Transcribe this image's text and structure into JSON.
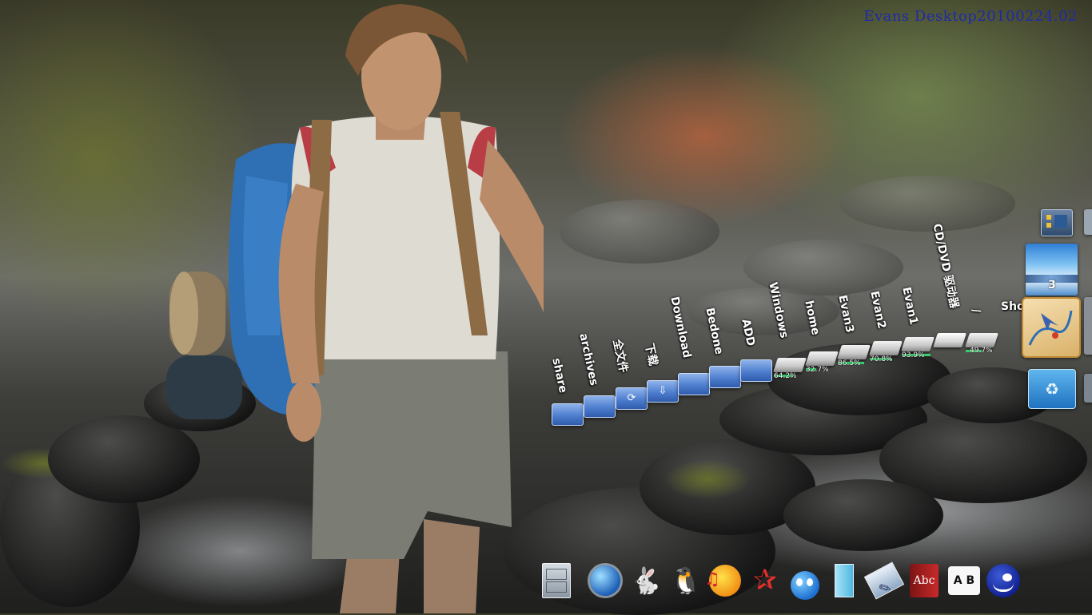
{
  "desktop": {
    "watermark": "Evans Desktop20100224.02"
  },
  "shelf": {
    "items": [
      {
        "id": "share",
        "label": "share",
        "kind": "folder",
        "glyph": ""
      },
      {
        "id": "archives",
        "label": "archives",
        "kind": "folder",
        "glyph": ""
      },
      {
        "id": "sync",
        "label": "全文件",
        "kind": "folder",
        "glyph": "⟳"
      },
      {
        "id": "downloads-cn",
        "label": "下载",
        "kind": "folder",
        "glyph": "⇩"
      },
      {
        "id": "download",
        "label": "Download",
        "kind": "folder",
        "glyph": ""
      },
      {
        "id": "bedone",
        "label": "Bedone",
        "kind": "folder",
        "glyph": ""
      },
      {
        "id": "add",
        "label": "ADD",
        "kind": "folder",
        "glyph": ""
      },
      {
        "id": "windows",
        "label": "Windows",
        "kind": "drive",
        "usage": "64.2%"
      },
      {
        "id": "home",
        "label": "home",
        "kind": "drive",
        "usage": "32.7%"
      },
      {
        "id": "evan3",
        "label": "Evan3",
        "kind": "drive",
        "usage": "86.5%"
      },
      {
        "id": "evan2",
        "label": "Evan2",
        "kind": "drive",
        "usage": "70.8%"
      },
      {
        "id": "evan1",
        "label": "Evan1",
        "kind": "drive",
        "usage": "93.9%"
      },
      {
        "id": "cdrom",
        "label": "CD/DVD 驱动器",
        "kind": "disc",
        "usage": ""
      },
      {
        "id": "root",
        "label": "/",
        "kind": "drive",
        "usage": "49.7%"
      }
    ]
  },
  "right_panel": {
    "workspace_number": "3",
    "shortcuts_label": "Shortcuts"
  },
  "dock": {
    "items": [
      {
        "id": "file-cabinet",
        "icon": "file-cabinet-icon"
      },
      {
        "id": "browser",
        "icon": "globe-icon"
      },
      {
        "id": "bunny",
        "icon": "rabbit-icon"
      },
      {
        "id": "tux",
        "icon": "penguin-icon"
      },
      {
        "id": "music",
        "icon": "music-player-icon"
      },
      {
        "id": "star",
        "icon": "star-icon"
      },
      {
        "id": "messenger",
        "icon": "messenger-icon"
      },
      {
        "id": "window",
        "icon": "window-icon"
      },
      {
        "id": "quill",
        "icon": "quill-icon"
      },
      {
        "id": "dictionary",
        "icon": "dictionary-icon",
        "label": "Abc"
      },
      {
        "id": "translator",
        "icon": "translator-icon",
        "label": "A B"
      },
      {
        "id": "emoticon",
        "icon": "smiley-icon"
      }
    ]
  }
}
